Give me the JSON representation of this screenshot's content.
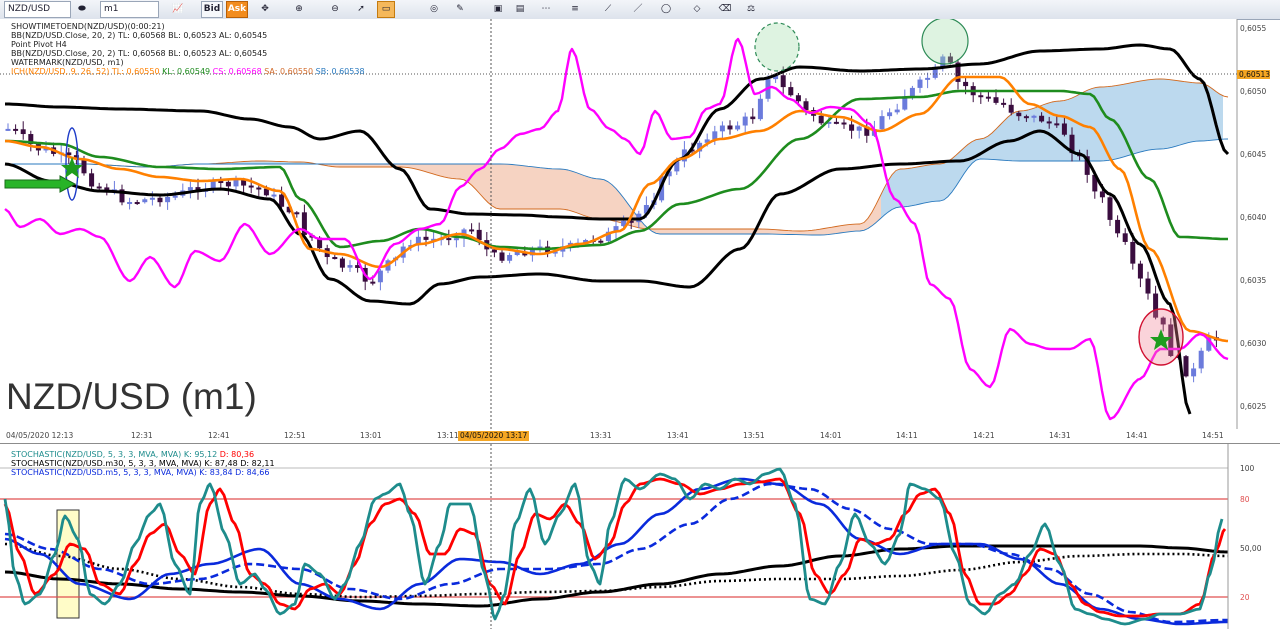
{
  "toolbar": {
    "symbol": "NZD/USD",
    "timeframe": "m1",
    "bid_label": "Bid",
    "ask_label": "Ask"
  },
  "upper_legend": {
    "line1": "SHOWTIMETOEND(NZD/USD)(0:00:21)",
    "line2": "BB(NZD/USD.Close, 20, 2)  TL: 0,60568  BL: 0,60523  AL: 0,60545",
    "line3": "Point Pivot H4",
    "line4": "BB(NZD/USD.Close, 20, 2)  TL: 0,60568  BL: 0,60523  AL: 0,60545",
    "line5": "WATERMARK(NZD/USD, m1)",
    "ich_name": "ICH(NZD/USD, 9, 26, 52)",
    "ich_tl": "TL: 0,60550",
    "ich_kl": "KL: 0,60549",
    "ich_cs": "CS: 0,60568",
    "ich_sa": "SA: 0,60550",
    "ich_sb": "SB: 0,60538"
  },
  "watermark": "NZD/USD (m1)",
  "current_price": "0,60513",
  "crosshair_time": "04/05/2020 13:17",
  "lower_legend": {
    "line1_name": "STOCHASTIC(NZD/USD, 5, 3, 3, MVA, MVA)",
    "line1_k": "K: 95,12",
    "line1_d": "D: 80,36",
    "line2": "STOCHASTIC(NZD/USD.m30, 5, 3, 3, MVA, MVA)  K: 87,48  D: 82,11",
    "line3": "STOCHASTIC(NZD/USD.m5, 5, 3, 3, MVA, MVA)  K: 83,84  D: 84,66"
  },
  "colors": {
    "bull_candle": "#6b7bdc",
    "bear_candle": "#3a0d3f",
    "bollinger": "#000000",
    "tenkan": "#ff8000",
    "kijun": "#1e8c1e",
    "chikou": "#ff00ff",
    "kumo_bull": "#bcd9ee",
    "kumo_bear": "#f6d3c2",
    "stoch_k": "#1e8c8c",
    "stoch_d": "#ff0000",
    "stoch_m5": "#0a2adc",
    "stoch_m30": "#000000"
  },
  "chart_data": [
    {
      "type": "candlestick",
      "title": "NZD/USD (m1)",
      "x_tick_labels": [
        "04/05/2020 12:13",
        "12:31",
        "12:41",
        "12:51",
        "13:01",
        "13:11",
        "13:31",
        "13:41",
        "13:51",
        "14:01",
        "14:11",
        "14:21",
        "14:31",
        "14:41",
        "14:51"
      ],
      "y_tick_labels": [
        "0,6055",
        "0,6050",
        "0,6045",
        "0,6040",
        "0,6035",
        "0,6030",
        "0,6025"
      ],
      "ylim": [
        0.60245,
        0.60565
      ],
      "indicators": [
        "Bollinger Bands (20, 2)",
        "Ichimoku (9, 26, 52)"
      ],
      "current_price": 0.60513
    },
    {
      "type": "line",
      "title": "Stochastic",
      "y_tick_labels": [
        "100",
        "80",
        "50,00",
        "20"
      ],
      "ylim": [
        0,
        100
      ],
      "series": [
        {
          "name": "STOCHASTIC(NZD/USD, 5, 3, 3, MVA, MVA) K",
          "last": 95.12
        },
        {
          "name": "STOCHASTIC(NZD/USD, 5, 3, 3, MVA, MVA) D",
          "last": 80.36
        },
        {
          "name": "STOCHASTIC(NZD/USD.m30) K",
          "last": 87.48
        },
        {
          "name": "STOCHASTIC(NZD/USD.m30) D",
          "last": 82.11
        },
        {
          "name": "STOCHASTIC(NZD/USD.m5) K",
          "last": 83.84
        },
        {
          "name": "STOCHASTIC(NZD/USD.m5) D",
          "last": 84.66
        }
      ]
    }
  ]
}
